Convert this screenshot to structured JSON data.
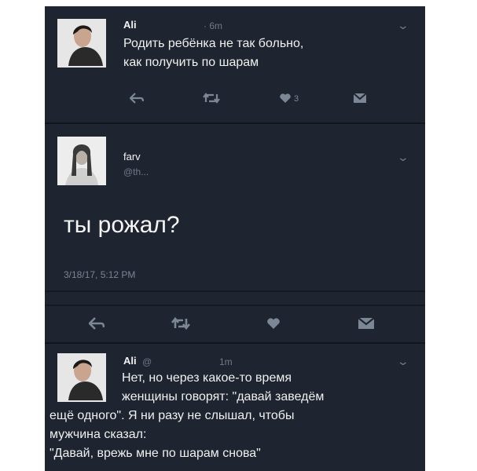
{
  "tweet1": {
    "name": "Ali",
    "meta": "· 6m",
    "text_lines": [
      "Родить ребёнка не так больно,",
      "как получить по шарам"
    ],
    "like_count": "3"
  },
  "tweet2": {
    "name": "farv",
    "handle": "@th...",
    "text": "ты рожал?",
    "date": "3/18/17, 5:12 PM"
  },
  "tweet3": {
    "name": "Ali",
    "handle": "@",
    "meta": "1m",
    "text_lines": [
      "Нет, но через какое-то время",
      "женщины говорят: \"давай заведём",
      "ещё одного\". Я ни разу не слышал, чтобы",
      "мужчина сказал:",
      "\"Давай, врежь мне по шарам снова\""
    ]
  },
  "colors": {
    "background": "#1f2530",
    "text": "#f0f0f0",
    "muted": "#7c8796"
  },
  "icons": [
    "reply-icon",
    "retweet-icon",
    "heart-icon",
    "message-icon",
    "chevron-down-icon"
  ]
}
